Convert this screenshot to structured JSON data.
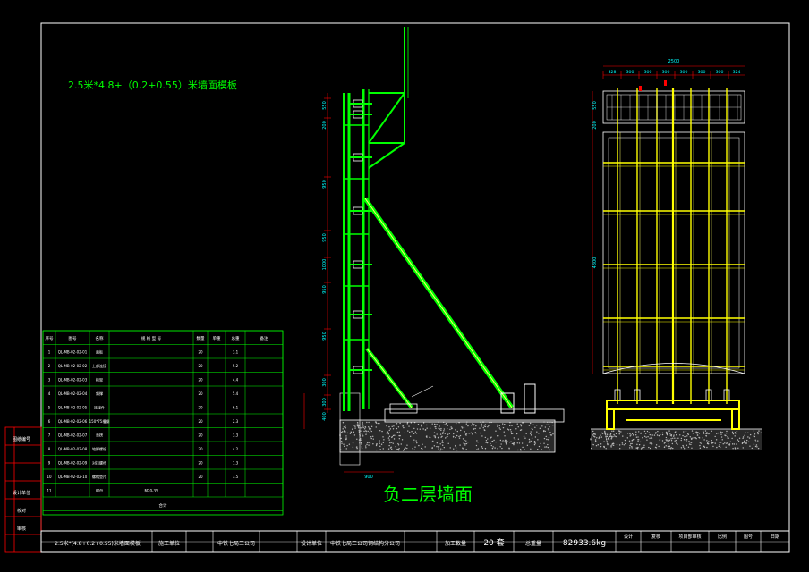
{
  "drawing": {
    "title_note": "2.5米*4.8+（0.2+0.55）米墙面模板",
    "section_label": "负二层墙面"
  },
  "left_strip": {
    "labels": [
      "图纸编号",
      "设计单位",
      "校对",
      "审核"
    ]
  },
  "title_block": {
    "name": "2.5米*(4.8+0.2+0.55)米墙面模板",
    "construction_unit_label": "施工单位",
    "construction_unit_value": "中铁七局三公司",
    "design_unit_label": "设计单位",
    "design_unit_value": "中铁七局三公司钢结构分公司",
    "quantity_label": "加工数量",
    "quantity_value": "20 套",
    "weight_label": "总重量",
    "weight_value": "82933.6kg",
    "sign_labels": [
      "设计",
      "复核",
      "项目部审核",
      "比例",
      "图号",
      "日期"
    ]
  },
  "parts_table": {
    "headers": [
      "序号",
      "图号",
      "名称",
      "规 格 型 号",
      "数量",
      "单重",
      "总重",
      "备注"
    ],
    "rows": [
      {
        "no": "1",
        "drawing": "QL-MB-02-02-01",
        "name": "面板",
        "spec": "",
        "qty": "20",
        "unit": "",
        "total": "3.1"
      },
      {
        "no": "2",
        "drawing": "QL-MB-02-02-02",
        "name": "上部连接",
        "spec": "",
        "qty": "20",
        "unit": "",
        "total": "5.2"
      },
      {
        "no": "3",
        "drawing": "QL-MB-02-02-03",
        "name": "桁架",
        "spec": "",
        "qty": "20",
        "unit": "",
        "total": "4.4"
      },
      {
        "no": "4",
        "drawing": "QL-MB-02-02-04",
        "name": "斜撑",
        "spec": "",
        "qty": "20",
        "unit": "",
        "total": "5.4"
      },
      {
        "no": "5",
        "drawing": "QL-MB-02-02-05",
        "name": "连接件",
        "spec": "",
        "qty": "20",
        "unit": "",
        "total": "6.1"
      },
      {
        "no": "6",
        "drawing": "QL-MB-02-02-06",
        "name": "150*75槽钢",
        "spec": "",
        "qty": "20",
        "unit": "",
        "total": "2.3"
      },
      {
        "no": "7",
        "drawing": "QL-MB-02-02-07",
        "name": "背楞",
        "spec": "",
        "qty": "20",
        "unit": "",
        "total": "3.3"
      },
      {
        "no": "8",
        "drawing": "QL-MB-02-02-08",
        "name": "地脚螺栓",
        "spec": "",
        "qty": "20",
        "unit": "",
        "total": "4.2"
      },
      {
        "no": "9",
        "drawing": "QL-MB-02-02-09",
        "name": "对拉螺杆",
        "spec": "",
        "qty": "20",
        "unit": "",
        "total": "1.3"
      },
      {
        "no": "10",
        "drawing": "QL-MB-02-02-10",
        "name": "螺帽垫片",
        "spec": "",
        "qty": "20",
        "unit": "",
        "total": "3.5"
      },
      {
        "no": "11",
        "drawing": "",
        "name": "螺母",
        "spec": "M20-35",
        "qty": "",
        "unit": "",
        "total": ""
      }
    ],
    "total_label": "合计"
  },
  "left_dims": [
    "550",
    "200",
    "950",
    "950",
    "1000",
    "950",
    "950",
    "300",
    "300",
    "400"
  ],
  "left_base_dim": "900",
  "right_top_dim": "2500",
  "right_sub_dims": [
    "328",
    "300",
    "300",
    "300",
    "300",
    "300",
    "300",
    "324"
  ],
  "right_side_dims": [
    "550",
    "200",
    "4800"
  ],
  "colors": {
    "background": "#000000",
    "border": "#ffffff",
    "green": "#00ff00",
    "yellow": "#ffff00",
    "red": "#ff0000",
    "cyan": "#00ffff",
    "orange": "#ffa500"
  }
}
